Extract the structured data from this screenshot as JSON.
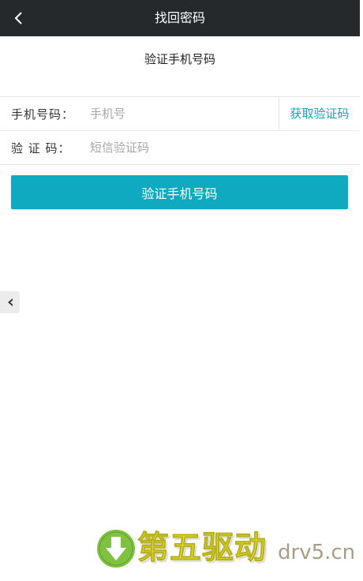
{
  "header": {
    "title": "找回密码",
    "back_icon": "chevron-left-icon"
  },
  "subtitle": "验证手机号码",
  "form": {
    "phone": {
      "label": "手机号码：",
      "placeholder": "手机号",
      "value": ""
    },
    "get_code_label": "获取验证码",
    "code": {
      "label": "验 证 码：",
      "placeholder": "短信验证码",
      "value": ""
    }
  },
  "submit_label": "验证手机号码",
  "side_tab_icon": "caret-left-icon",
  "watermark": {
    "logo": "download-arrow-icon",
    "text_cn": "第五驱动",
    "text_en": "drv5.cn"
  },
  "colors": {
    "header_bg": "#26292c",
    "accent": "#10aac0",
    "link": "#18a4b6",
    "watermark_yellow": "#f5ec3d",
    "watermark_green": "#7fc241"
  }
}
